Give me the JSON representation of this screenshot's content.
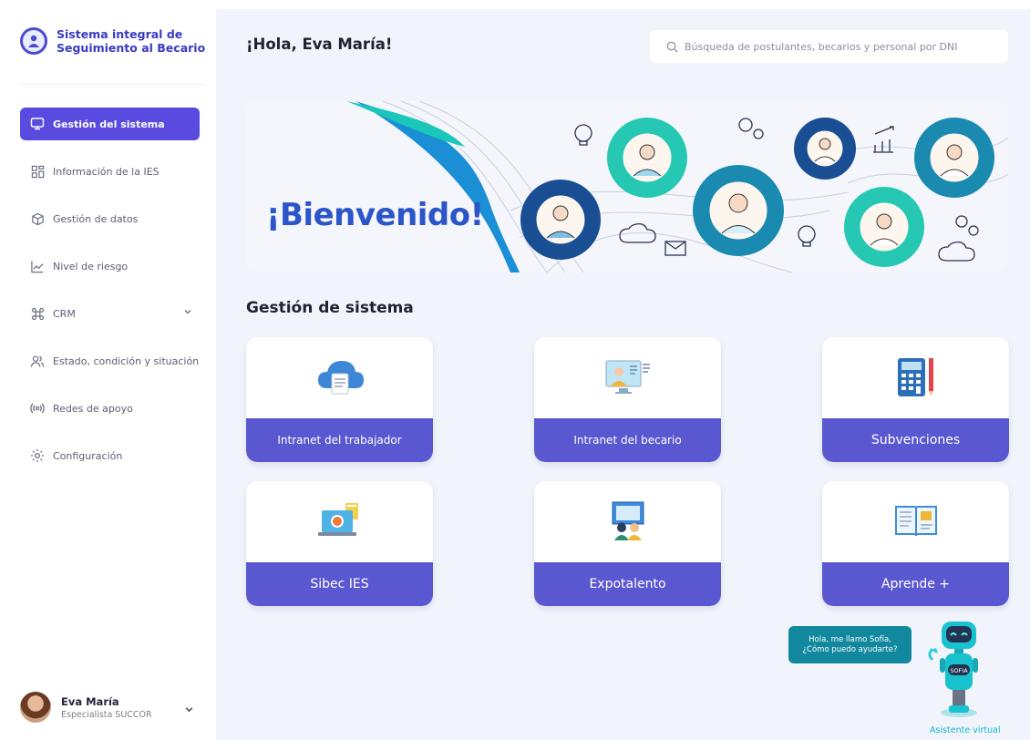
{
  "brand": {
    "title_line1": "Sistema integral de",
    "title_line2": "Seguimiento al Becario"
  },
  "sidebar": {
    "items": [
      {
        "label": "Gestión del sistema",
        "icon": "monitor-icon",
        "active": true
      },
      {
        "label": "Información de la IES",
        "icon": "grid-icon"
      },
      {
        "label": "Gestión de datos",
        "icon": "cube-icon"
      },
      {
        "label": "Nivel de riesgo",
        "icon": "trend-chart-icon"
      },
      {
        "label": "CRM",
        "icon": "command-icon",
        "has_chevron": true
      },
      {
        "label": "Estado, condición y situación",
        "icon": "users-icon"
      },
      {
        "label": "Redes de apoyo",
        "icon": "broadcast-icon"
      },
      {
        "label": "Configuración",
        "icon": "gear-icon"
      }
    ]
  },
  "user": {
    "name": "Eva María",
    "role": "Especialista SUCCOR"
  },
  "header": {
    "greeting": "¡Hola, Eva María!",
    "search_placeholder": "Búsqueda de postulantes, becarios y personal por DNI"
  },
  "banner": {
    "title": "¡Bienvenido!"
  },
  "section": {
    "title": "Gestión de sistema"
  },
  "cards": [
    {
      "label": "Intranet del trabajador",
      "icon": "cloud-document-icon"
    },
    {
      "label": "Intranet del becario",
      "icon": "student-monitor-icon"
    },
    {
      "label": "Subvenciones",
      "icon": "calculator-icon"
    },
    {
      "label": "Sibec IES",
      "icon": "laptop-folder-icon"
    },
    {
      "label": "Expotalento",
      "icon": "presentation-icon"
    },
    {
      "label": "Aprende +",
      "icon": "open-book-icon"
    }
  ],
  "assistant": {
    "bubble_line1": "Hola, me llamo Sofía,",
    "bubble_line2": "¿Cómo puedo ayudarte?",
    "bot_badge": "SOFIA",
    "label": "Asistente virtual"
  },
  "colors": {
    "primary": "#5a4be0",
    "card_footer": "#5a58d0",
    "accent_teal": "#15b7c9",
    "banner_title": "#2b55c9",
    "background": "#f1f4fb"
  }
}
